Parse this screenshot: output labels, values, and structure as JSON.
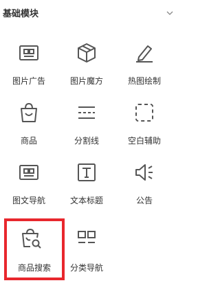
{
  "section": {
    "title": "基础模块",
    "collapse_icon": "chevron-down-icon"
  },
  "modules": [
    {
      "label": "图片广告",
      "icon": "image-ad-icon"
    },
    {
      "label": "图片魔方",
      "icon": "cube-icon"
    },
    {
      "label": "热图绘制",
      "icon": "pencil-icon"
    },
    {
      "label": "商品",
      "icon": "shopping-bag-icon"
    },
    {
      "label": "分割线",
      "icon": "divider-icon"
    },
    {
      "label": "空白辅助",
      "icon": "dashed-square-icon"
    },
    {
      "label": "图文导航",
      "icon": "image-text-nav-icon"
    },
    {
      "label": "文本标题",
      "icon": "text-title-icon"
    },
    {
      "label": "公告",
      "icon": "speaker-icon"
    },
    {
      "label": "商品搜索",
      "icon": "bag-search-icon",
      "highlighted": true
    },
    {
      "label": "分类导航",
      "icon": "grid-nav-icon"
    }
  ],
  "colors": {
    "icon": "#555555",
    "highlight": "#e8272d"
  }
}
